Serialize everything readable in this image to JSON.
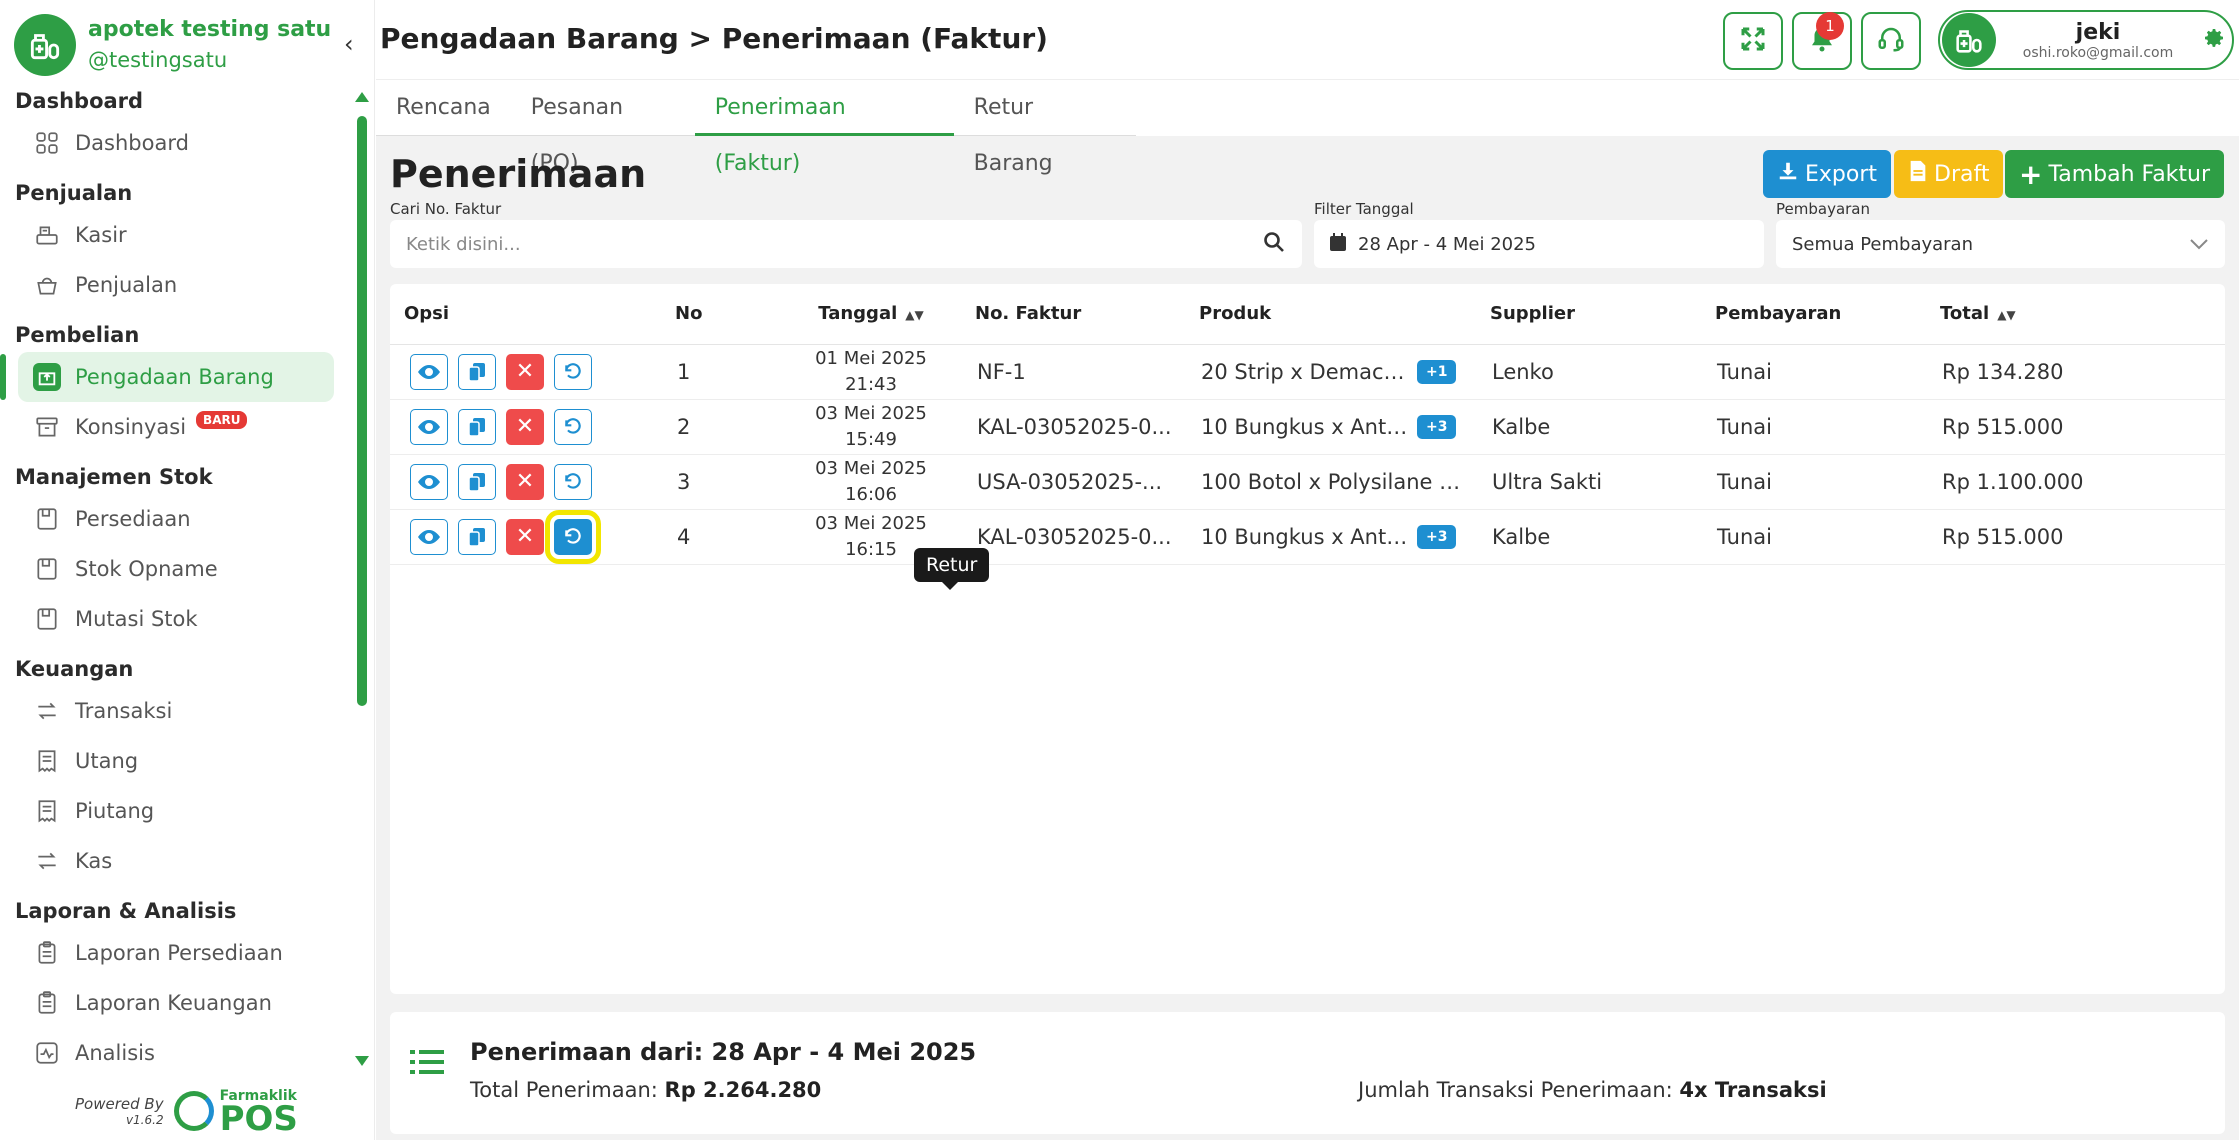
{
  "brand": {
    "name": "apotek testing satu",
    "handle": "@testingsatu"
  },
  "sidebar": {
    "sections": [
      {
        "title": "Dashboard",
        "items": [
          {
            "label": "Dashboard",
            "icon": "grid-icon"
          }
        ]
      },
      {
        "title": "Penjualan",
        "items": [
          {
            "label": "Kasir",
            "icon": "cash-register-icon"
          },
          {
            "label": "Penjualan",
            "icon": "basket-icon"
          }
        ]
      },
      {
        "title": "Pembelian",
        "items": [
          {
            "label": "Pengadaan Barang",
            "icon": "box-icon",
            "active": true
          },
          {
            "label": "Konsinyasi",
            "icon": "archive-icon",
            "badge": "BARU"
          }
        ]
      },
      {
        "title": "Manajemen Stok",
        "items": [
          {
            "label": "Persediaan",
            "icon": "inventory-icon"
          },
          {
            "label": "Stok Opname",
            "icon": "inventory-icon"
          },
          {
            "label": "Mutasi Stok",
            "icon": "inventory-icon"
          }
        ]
      },
      {
        "title": "Keuangan",
        "items": [
          {
            "label": "Transaksi",
            "icon": "transfer-icon"
          },
          {
            "label": "Utang",
            "icon": "receipt-icon"
          },
          {
            "label": "Piutang",
            "icon": "receipt-icon"
          },
          {
            "label": "Kas",
            "icon": "transfer-icon"
          }
        ]
      },
      {
        "title": "Laporan & Analisis",
        "items": [
          {
            "label": "Laporan Persediaan",
            "icon": "clipboard-icon"
          },
          {
            "label": "Laporan Keuangan",
            "icon": "clipboard-icon"
          },
          {
            "label": "Analisis",
            "icon": "chart-icon"
          }
        ]
      }
    ],
    "powered_by": "Powered By",
    "version": "v1.6.2",
    "logo_small": "Farmaklik",
    "logo_big": "POS"
  },
  "header": {
    "title": "Pengadaan Barang > Penerimaan (Faktur)",
    "notification_count": "1",
    "user": {
      "name": "jeki",
      "email": "oshi.roko@gmail.com"
    }
  },
  "tabs": [
    {
      "label": "Rencana",
      "active": false
    },
    {
      "label": "Pesanan (PO)",
      "active": false
    },
    {
      "label": "Penerimaan (Faktur)",
      "active": true
    },
    {
      "label": "Retur Barang",
      "active": false
    }
  ],
  "main": {
    "title": "Penerimaan",
    "buttons": {
      "export": "Export",
      "draft": "Draft",
      "add": "Tambah Faktur"
    },
    "search": {
      "label": "Cari No. Faktur",
      "placeholder": "Ketik disini..."
    },
    "date_filter": {
      "label": "Filter Tanggal",
      "value": "28 Apr - 4 Mei 2025"
    },
    "payment_filter": {
      "label": "Pembayaran",
      "value": "Semua Pembayaran"
    }
  },
  "table": {
    "headers": {
      "opsi": "Opsi",
      "no": "No",
      "tanggal": "Tanggal",
      "faktur": "No. Faktur",
      "produk": "Produk",
      "supplier": "Supplier",
      "pembayaran": "Pembayaran",
      "total": "Total"
    },
    "rows": [
      {
        "no": "1",
        "date": "01 Mei 2025",
        "time": "21:43",
        "faktur": "NF-1",
        "produk": "20 Strip x Demacol...",
        "more": "+1",
        "supplier": "Lenko",
        "pembayaran": "Tunai",
        "total": "Rp 134.280"
      },
      {
        "no": "2",
        "date": "03 Mei 2025",
        "time": "15:49",
        "faktur": "KAL-03052025-0...",
        "produk": "10 Bungkus x Anta...",
        "more": "+3",
        "supplier": "Kalbe",
        "pembayaran": "Tunai",
        "total": "Rp 515.000"
      },
      {
        "no": "3",
        "date": "03 Mei 2025",
        "time": "16:06",
        "faktur": "USA-03052025-...",
        "produk": "100 Botol x Polysilane 18...",
        "more": "",
        "supplier": "Ultra Sakti",
        "pembayaran": "Tunai",
        "total": "Rp 1.100.000"
      },
      {
        "no": "4",
        "date": "03 Mei 2025",
        "time": "16:15",
        "faktur": "KAL-03052025-0...",
        "produk": "10 Bungkus x Anta...",
        "more": "+3",
        "supplier": "Kalbe",
        "pembayaran": "Tunai",
        "total": "Rp 515.000"
      }
    ],
    "tooltip": "Retur"
  },
  "summary": {
    "title": "Penerimaan dari: 28 Apr - 4 Mei 2025",
    "total_label": "Total Penerimaan:",
    "total_value": "Rp 2.264.280",
    "count_label": "Jumlah Transaksi Penerimaan:",
    "count_value": "4x Transaksi"
  },
  "colors": {
    "brand_green": "#2e9e45",
    "export_blue": "#1e8fd1",
    "draft_yellow": "#f6bd16",
    "danger_red": "#ef4b4b",
    "highlight_yellow": "#f2e600"
  }
}
